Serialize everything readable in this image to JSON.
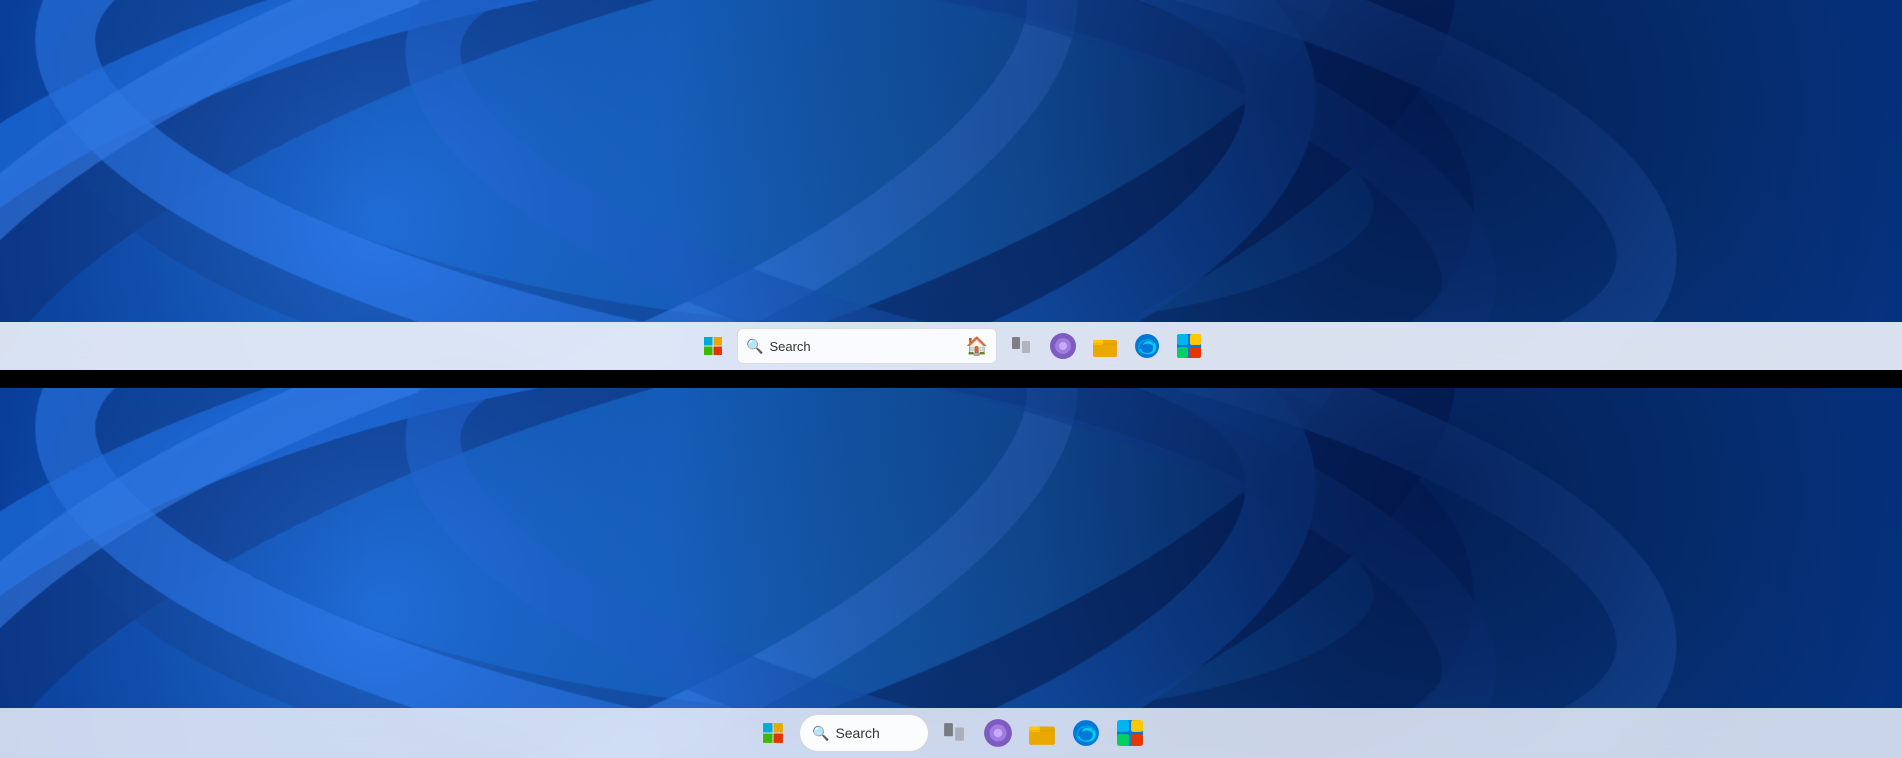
{
  "screens": [
    {
      "id": "top-screen",
      "taskbar": {
        "search_placeholder": "Search",
        "search_text": "Search",
        "icons": [
          {
            "name": "lighthouse",
            "emoji": "🏠",
            "label": "Lighthouse"
          },
          {
            "name": "task-view",
            "emoji": "⬛",
            "label": "Task View"
          },
          {
            "name": "webex",
            "emoji": "💬",
            "label": "Webex"
          },
          {
            "name": "file-explorer",
            "emoji": "📁",
            "label": "File Explorer"
          },
          {
            "name": "edge",
            "emoji": "🌐",
            "label": "Microsoft Edge"
          },
          {
            "name": "ms-store",
            "emoji": "🛒",
            "label": "Microsoft Store"
          }
        ]
      }
    },
    {
      "id": "bottom-screen",
      "taskbar": {
        "search_placeholder": "Search",
        "search_text": "Search",
        "icons": [
          {
            "name": "task-view",
            "emoji": "⬛",
            "label": "Task View"
          },
          {
            "name": "webex",
            "emoji": "💬",
            "label": "Webex"
          },
          {
            "name": "file-explorer",
            "emoji": "📁",
            "label": "File Explorer"
          },
          {
            "name": "edge",
            "emoji": "🌐",
            "label": "Microsoft Edge"
          },
          {
            "name": "ms-store",
            "emoji": "🛒",
            "label": "Microsoft Store"
          }
        ]
      }
    }
  ],
  "colors": {
    "wallpaper_primary": "#1565d8",
    "wallpaper_dark": "#0030a0",
    "wallpaper_mid": "#0b5bc8",
    "taskbar_bg": "rgba(235,240,250,0.92)",
    "black_bar": "#000000"
  }
}
